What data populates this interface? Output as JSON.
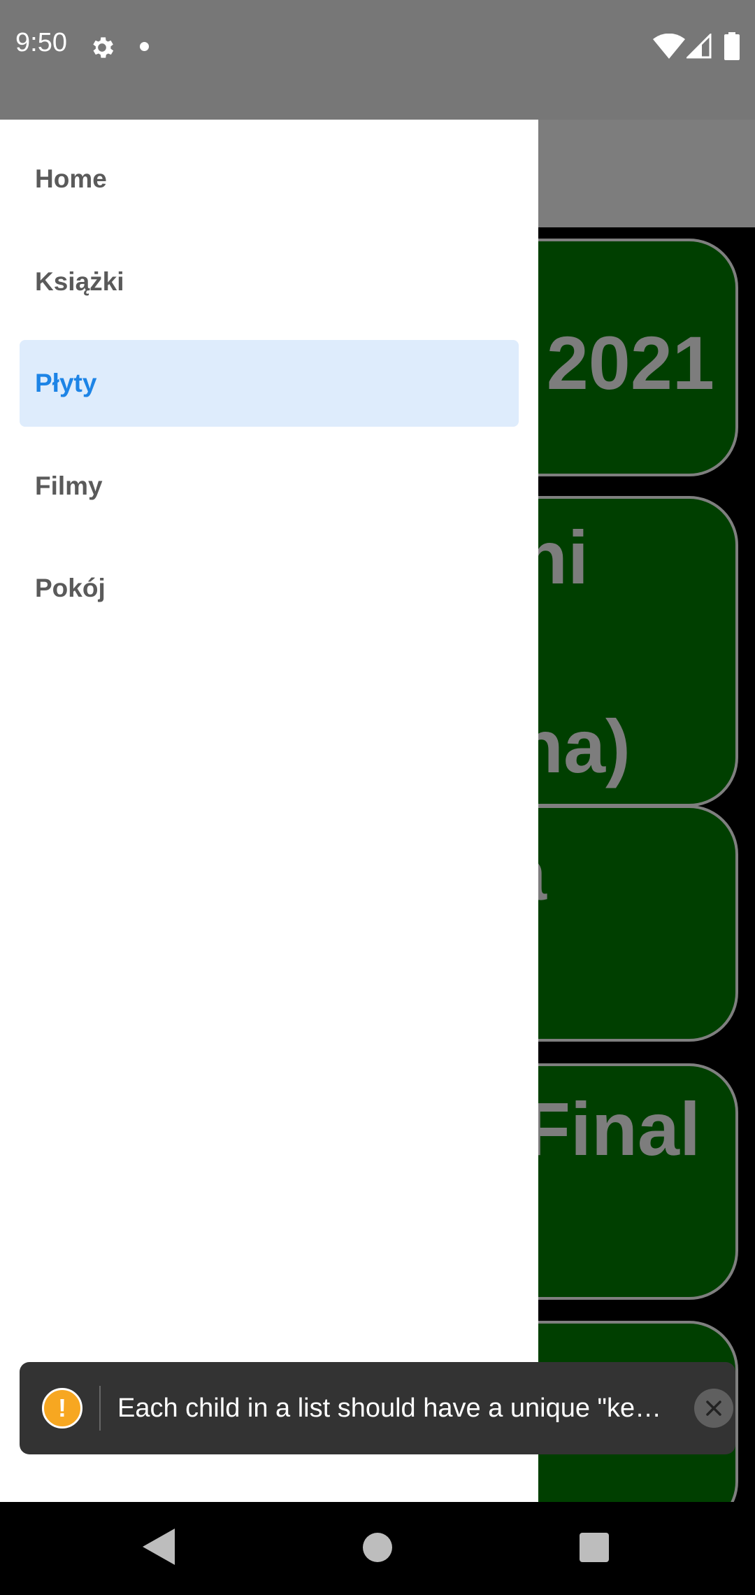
{
  "status_bar": {
    "time": "9:50",
    "icons": [
      "gear-icon",
      "notification-dot-icon",
      "wifi-icon",
      "signal-icon",
      "battery-icon"
    ]
  },
  "background": {
    "card_texts": [
      "2021",
      "ni",
      "na)",
      "a",
      "Final"
    ]
  },
  "drawer": {
    "items": [
      {
        "label": "Home",
        "active": false
      },
      {
        "label": "Książki",
        "active": false
      },
      {
        "label": "Płyty",
        "active": true
      },
      {
        "label": "Filmy",
        "active": false
      },
      {
        "label": "Pokój",
        "active": false
      }
    ]
  },
  "toast": {
    "icon_glyph": "!",
    "message": "Each child in a list should have a unique \"ke…"
  },
  "nav_bar": {
    "icons": [
      "back-icon",
      "home-icon",
      "recents-icon"
    ]
  },
  "colors": {
    "drawer_active_bg": "#deecfc",
    "drawer_active_text": "#1d84e6",
    "card_bg": "#003f00",
    "warning": "#f7a721"
  }
}
